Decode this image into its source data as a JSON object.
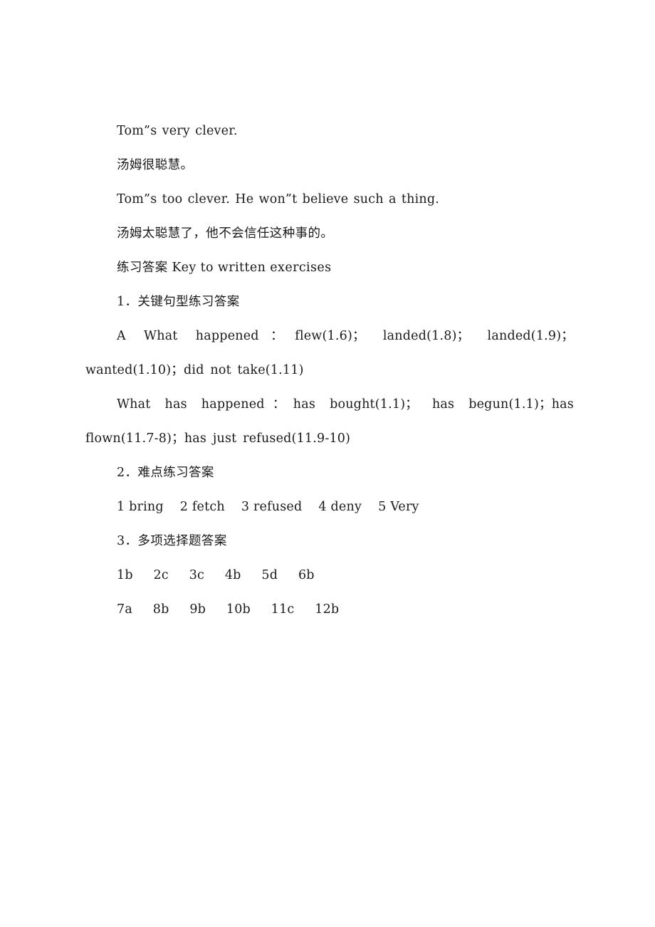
{
  "document": {
    "page_background": "#ffffff",
    "text_color": "#1a1a1a",
    "blocks": [
      {
        "id": "line-tom-clever-en",
        "kind": "english-sentence",
        "text": "Tom”s very clever."
      },
      {
        "id": "line-tom-clever-zh",
        "kind": "chinese-translation",
        "text": "汤姆很聪慧。"
      },
      {
        "id": "line-tom-too-clever-en",
        "kind": "english-sentence",
        "text": "Tom”s too clever. He won”t believe such a thing."
      },
      {
        "id": "line-tom-too-clever-zh",
        "kind": "chinese-translation",
        "text": "汤姆太聪慧了，他不会信任这种事的。"
      },
      {
        "id": "heading-key-to-exercises",
        "kind": "section-heading",
        "text": "练习答案 Key to written exercises"
      },
      {
        "id": "heading-section-1",
        "kind": "numbered-heading",
        "text": "1．关键句型练习答案"
      },
      {
        "id": "answer-what-happened",
        "kind": "answer-paragraph",
        "text": "A  What  happened：flew(1.6)； landed(1.8)； landed(1.9)；wanted(1.10)；did not take(1.11)"
      },
      {
        "id": "answer-what-has-happened",
        "kind": "answer-paragraph",
        "text": "What has happened：has bought(1.1)； has begun(1.1)；has flown(11.7-8)；has just refused(11.9-10)"
      },
      {
        "id": "heading-section-2",
        "kind": "numbered-heading",
        "text": "2．难点练习答案"
      },
      {
        "id": "answer-difficult-points",
        "kind": "answer-list",
        "text": "1 bring    2 fetch    3 refused    4 deny    5 Very"
      },
      {
        "id": "heading-section-3",
        "kind": "numbered-heading",
        "text": "3．多项选择题答案"
      },
      {
        "id": "answer-multiple-choice-row-1",
        "kind": "answer-list",
        "text": "1b     2c     3c     4b     5d     6b"
      },
      {
        "id": "answer-multiple-choice-row-2",
        "kind": "answer-list",
        "text": "7a     8b     9b     10b     11c     12b"
      }
    ]
  }
}
